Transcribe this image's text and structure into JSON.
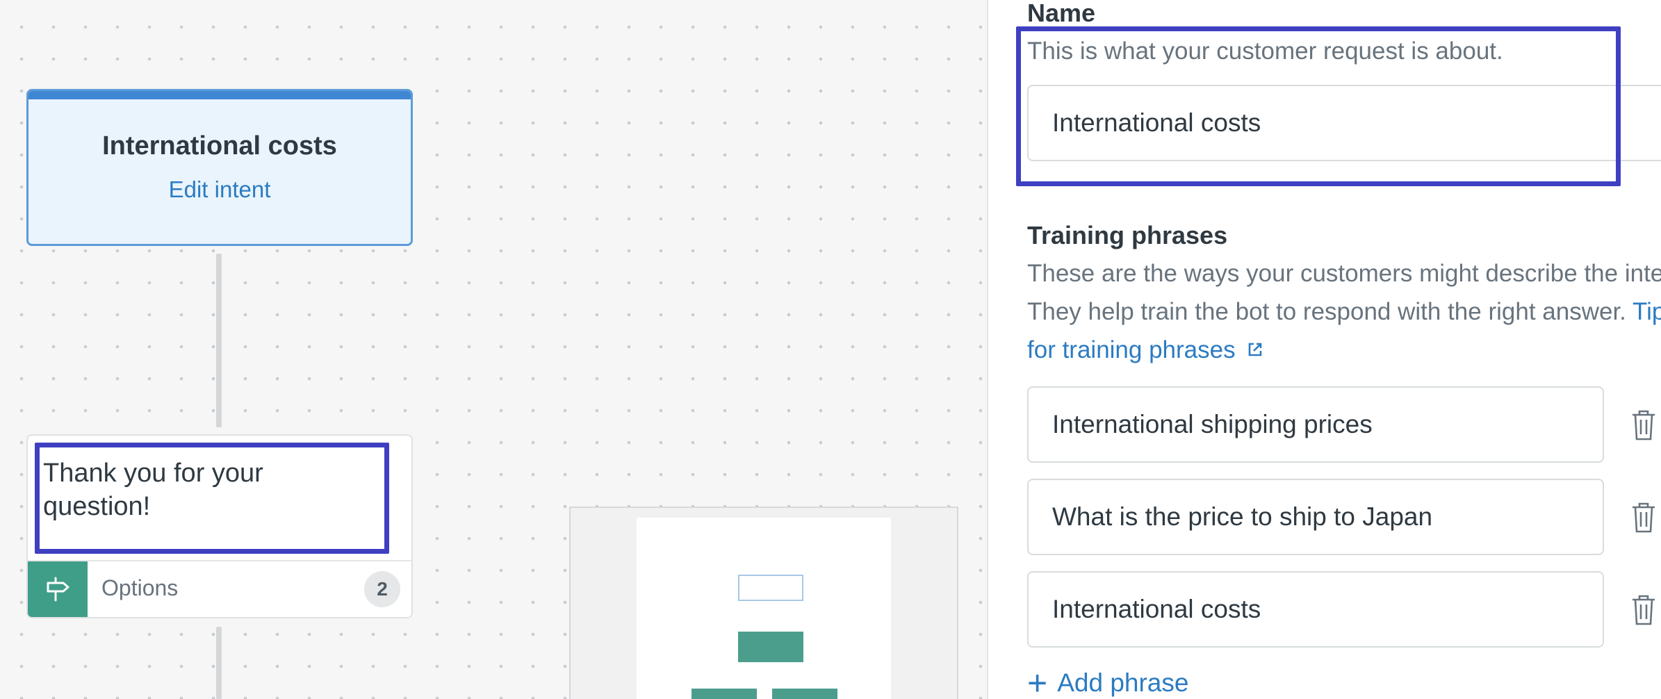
{
  "canvas": {
    "intent_node": {
      "title": "International costs",
      "edit_link": "Edit intent"
    },
    "message_node": {
      "text": "Thank you for your question!",
      "options_label": "Options",
      "options_count": "2",
      "options_icon": "signpost-icon"
    },
    "colors": {
      "accent_blue": "#3f87d2",
      "accent_green": "#3f9e88",
      "highlight": "#3f3fc2"
    }
  },
  "panel": {
    "name": {
      "label": "Name",
      "description": "This is what your customer request is about.",
      "value": "International costs"
    },
    "training": {
      "label": "Training phrases",
      "description": "These are the ways your customers might describe the intent. They help train the bot to respond with the right answer.",
      "tips_link": "Tips for training phrases",
      "phrases": [
        "International shipping prices",
        "What is the price to ship to Japan",
        "International costs"
      ],
      "add_phrase": "Add phrase"
    }
  }
}
